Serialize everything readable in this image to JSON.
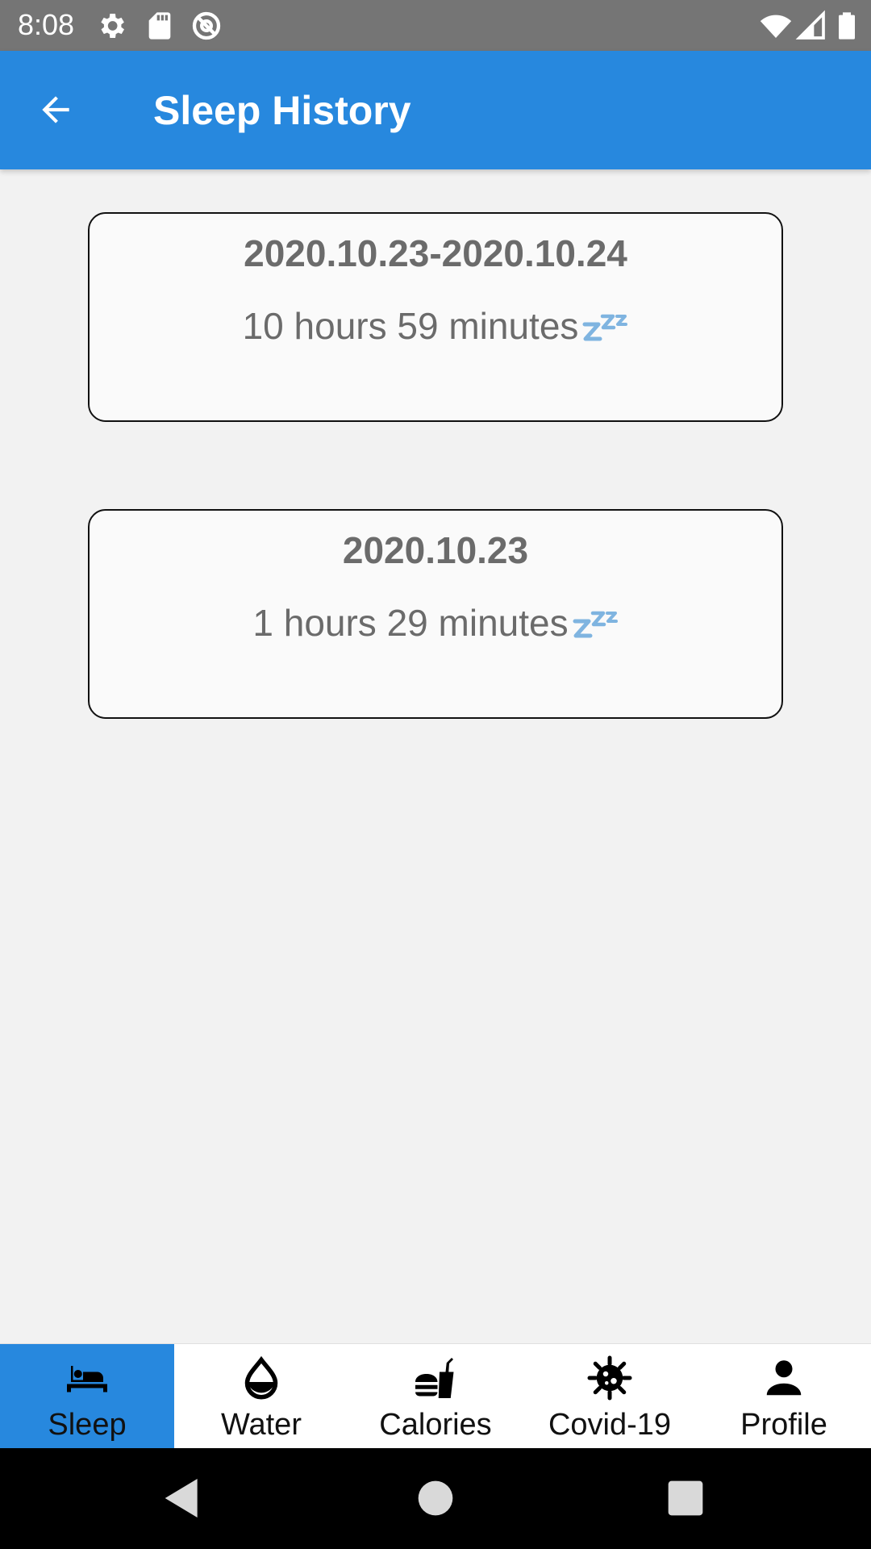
{
  "status_bar": {
    "time": "8:08",
    "icons": [
      "gear-icon",
      "sd-card-icon",
      "at-sign-icon",
      "wifi-icon",
      "cell-signal-icon",
      "battery-icon"
    ]
  },
  "app_bar": {
    "title": "Sleep History",
    "back_icon": "arrow-left-icon",
    "color": "#2788de"
  },
  "records": [
    {
      "date": "2020.10.23-2020.10.24",
      "duration": "10 hours 59 minutes",
      "icon": "zzz-icon"
    },
    {
      "date": "2020.10.23",
      "duration": "1 hours 29 minutes",
      "icon": "zzz-icon"
    }
  ],
  "bottom_nav": {
    "active": "Sleep",
    "items": [
      {
        "label": "Sleep",
        "icon": "bed-icon"
      },
      {
        "label": "Water",
        "icon": "water-drop-icon"
      },
      {
        "label": "Calories",
        "icon": "fastfood-icon"
      },
      {
        "label": "Covid-19",
        "icon": "virus-icon"
      },
      {
        "label": "Profile",
        "icon": "person-icon"
      }
    ]
  },
  "system_nav": {
    "buttons": [
      "back-triangle-icon",
      "home-circle-icon",
      "recents-square-icon"
    ]
  }
}
